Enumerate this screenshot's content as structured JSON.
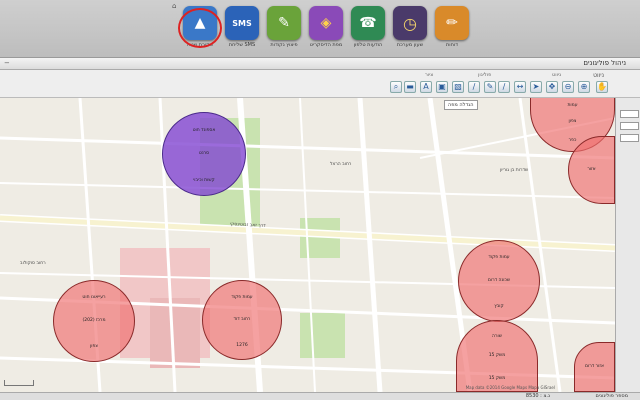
{
  "dock": {
    "top_mark": "⌂",
    "items": [
      {
        "label": "סקירת שטח",
        "color": "#3a78c8",
        "glyph": "▲",
        "icon": "map-pin-icon"
      },
      {
        "label": "שליחת SMS",
        "color": "#2b63b8",
        "glyph": "SMS",
        "icon": "sms-icon"
      },
      {
        "label": "פיצוץ נקודות",
        "color": "#6aa33a",
        "glyph": "✎",
        "icon": "notepad-icon"
      },
      {
        "label": "מפת הדיסקריט",
        "color": "#8a4ab8",
        "glyph": "◈",
        "icon": "folded-map-icon"
      },
      {
        "label": "הודעות טלפון",
        "color": "#2f8a54",
        "glyph": "☎",
        "icon": "phone-icon"
      },
      {
        "label": "שעון מערכת",
        "color": "#4a3a6a",
        "glyph": "◷",
        "icon": "clock-icon"
      },
      {
        "label": "דוחות",
        "color": "#d98a2a",
        "glyph": "✏",
        "icon": "pencil-icon"
      }
    ]
  },
  "panel": {
    "title": "ניהול פוליגונים",
    "close": "−"
  },
  "toolbar": {
    "sub_title": "ניווט",
    "groups": [
      "ציור",
      "פוליגון",
      "ניווט"
    ],
    "tooltip": "הגדלה מפה"
  },
  "circles": [
    {
      "top": "אספונד חוט",
      "mid": "סרנט",
      "bottom": "קשות וכיבוי"
    },
    {
      "top": "רעייאונו חוט",
      "mid": "מרכז (202)",
      "bottom": "צפון"
    },
    {
      "top": "עמות פקוד",
      "mid": "רחוב דוד",
      "bottom": "1276"
    },
    {
      "top": "עמות פקוד",
      "mid": "שכונה דרום",
      "bottom": "קובץ"
    },
    {
      "top": "שורה",
      "mid": "משק 15",
      "bottom": "15 משק"
    },
    {
      "top": "עמות",
      "mid": "צפון",
      "bottom": "כפר"
    },
    {
      "top": "אזור",
      "mid": "",
      "bottom": ""
    },
    {
      "top": "אזור דרום",
      "mid": "",
      "bottom": ""
    }
  ],
  "streets": [
    "דרך זאב זבוטינסקי",
    "רחוב הרצל",
    "שדרות בן גוריון",
    "רחוב סוקולוב"
  ],
  "attribution": "Map data ©2014 Google Maps Mapa GISrael",
  "status": {
    "page": "8530 : נ.צ",
    "text": "מספר פוליגונים"
  }
}
